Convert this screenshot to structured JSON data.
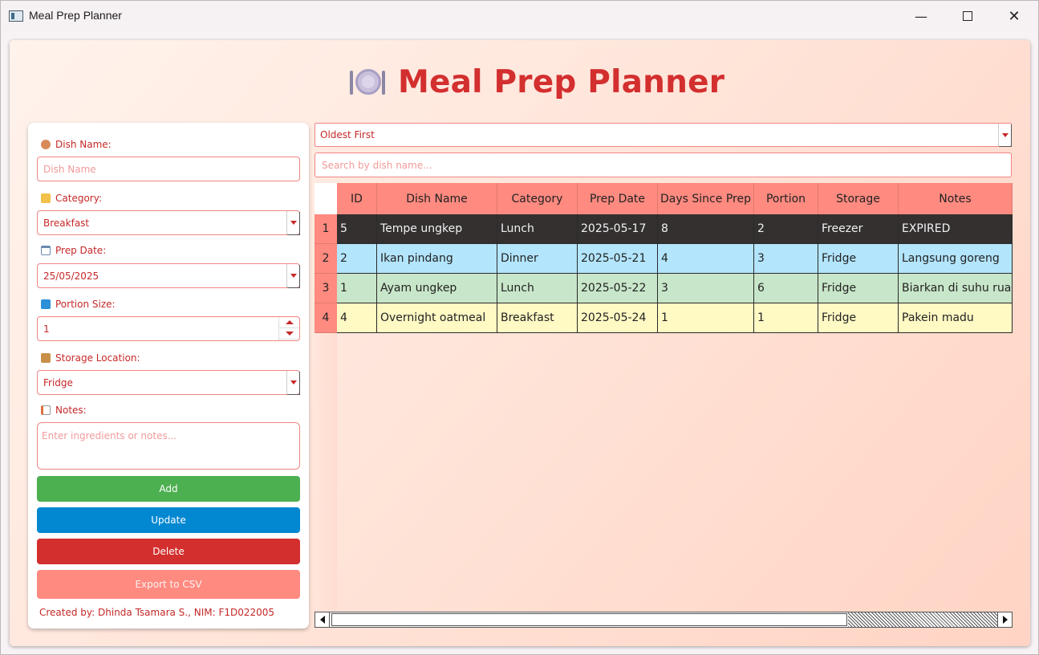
{
  "window": {
    "title": "Meal Prep Planner"
  },
  "header": {
    "title": "Meal Prep Planner"
  },
  "form": {
    "dish_name_label": "Dish Name:",
    "dish_name_placeholder": "Dish Name",
    "category_label": "Category:",
    "category_value": "Breakfast",
    "prep_date_label": "Prep Date:",
    "prep_date_value": "25/05/2025",
    "portion_label": "Portion Size:",
    "portion_value": "1",
    "storage_label": "Storage Location:",
    "storage_value": "Fridge",
    "notes_label": "Notes:",
    "notes_placeholder": "Enter ingredients or notes...",
    "add_label": "Add",
    "update_label": "Update",
    "delete_label": "Delete",
    "export_label": "Export to CSV",
    "credit": "Created by: Dhinda Tsamara S., NIM: F1D022005"
  },
  "sort": {
    "value": "Oldest First"
  },
  "search": {
    "placeholder": "Search by dish name..."
  },
  "table": {
    "columns": [
      "ID",
      "Dish Name",
      "Category",
      "Prep Date",
      "Days Since Prep",
      "Portion",
      "Storage",
      "Notes"
    ],
    "row_numbers": [
      "1",
      "2",
      "3",
      "4"
    ],
    "rows": [
      [
        "5",
        "Tempe ungkep",
        "Lunch",
        "2025-05-17",
        "8",
        "2",
        "Freezer",
        "EXPIRED"
      ],
      [
        "2",
        "Ikan pindang",
        "Dinner",
        "2025-05-21",
        "4",
        "3",
        "Fridge",
        "Langsung goreng"
      ],
      [
        "1",
        "Ayam ungkep",
        "Lunch",
        "2025-05-22",
        "3",
        "6",
        "Fridge",
        "Biarkan di suhu ruan..."
      ],
      [
        "4",
        "Overnight oatmeal",
        "Breakfast",
        "2025-05-24",
        "1",
        "1",
        "Fridge",
        "Pakein madu"
      ]
    ],
    "row_colors": [
      "#343030",
      "#b3e5fc",
      "#c8e6c9",
      "#fff9c4"
    ]
  },
  "colors": {
    "accent": "#d32f2f",
    "header": "#ff8a80",
    "add": "#4caf50",
    "update": "#0288d1",
    "delete": "#d32f2f"
  }
}
